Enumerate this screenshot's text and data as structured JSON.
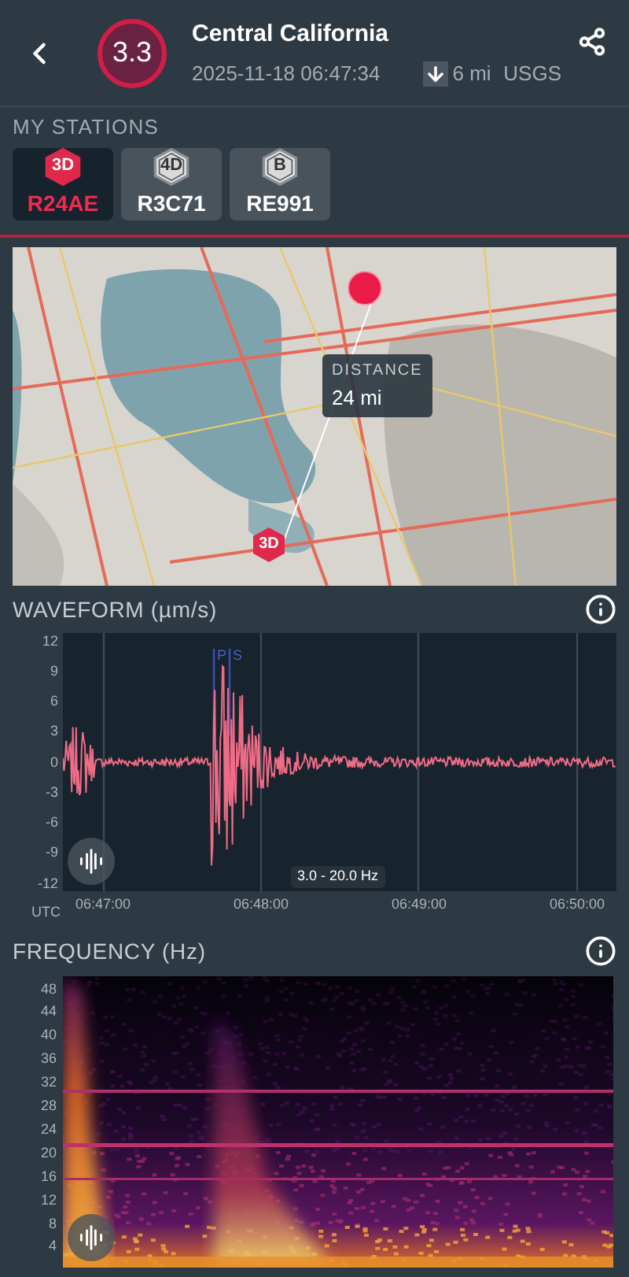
{
  "header": {
    "magnitude": "3.3",
    "title": "Central California",
    "datetime": "2025-11-18 06:47:34",
    "depth": "6 mi",
    "source": "USGS"
  },
  "stations_label": "MY STATIONS",
  "stations": [
    {
      "badge": "3D",
      "name": "R24AE",
      "selected": true
    },
    {
      "badge": "4D",
      "name": "R3C71",
      "selected": false
    },
    {
      "badge": "B",
      "name": "RE991",
      "selected": false
    }
  ],
  "map": {
    "distance_label": "DISTANCE",
    "distance_value": "24 mi",
    "station_badge": "3D"
  },
  "waveform": {
    "title": "WAVEFORM (µm/s)",
    "yticks": [
      "12",
      "9",
      "6",
      "3",
      "0",
      "-3",
      "-6",
      "-9",
      "-12"
    ],
    "phase_labels": [
      "P",
      "S"
    ],
    "filter": "3.0 - 20.0 Hz",
    "xunit": "UTC",
    "xticks": [
      "06:47:00",
      "06:48:00",
      "06:49:00",
      "06:50:00"
    ]
  },
  "frequency": {
    "title": "FREQUENCY (Hz)",
    "yticks": [
      "48",
      "44",
      "40",
      "36",
      "32",
      "28",
      "24",
      "20",
      "16",
      "12",
      "8",
      "4"
    ]
  }
}
